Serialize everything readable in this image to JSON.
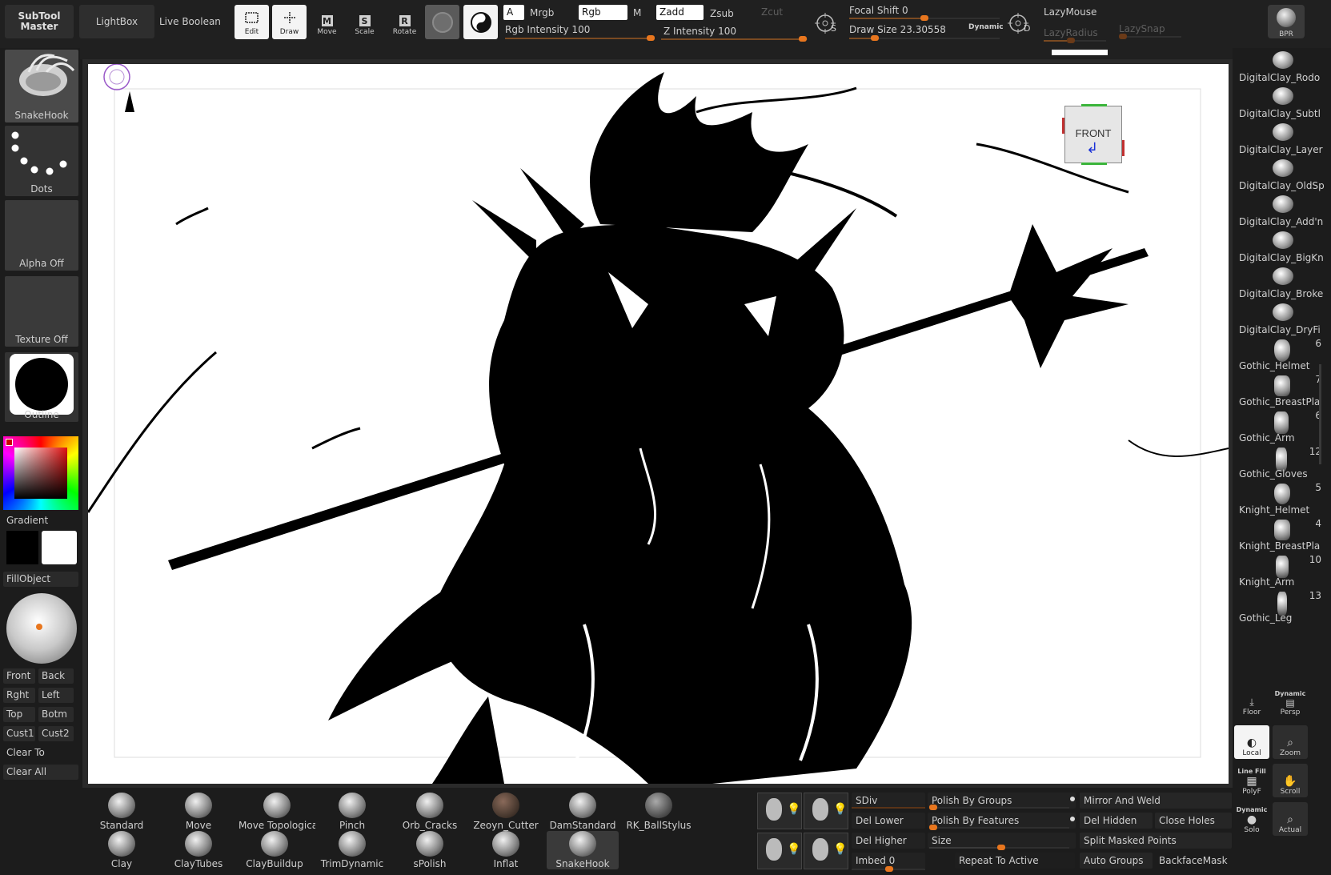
{
  "top": {
    "subtool_master": "SubTool Master",
    "lightbox": "LightBox",
    "live_boolean": "Live Boolean",
    "tools": [
      {
        "label": "Edit",
        "glyph": "⬚"
      },
      {
        "label": "Draw",
        "glyph": "✎"
      },
      {
        "label": "Move",
        "glyph": "M"
      },
      {
        "label": "Scale",
        "glyph": "S"
      },
      {
        "label": "Rotate",
        "glyph": "R"
      }
    ],
    "a_field": "A",
    "mrgb": "Mrgb",
    "rgb_field": "Rgb",
    "m": "M",
    "zadd_field": "Zadd",
    "zsub": "Zsub",
    "zcut": "Zcut",
    "rgb_intensity": "Rgb Intensity 100",
    "z_intensity": "Z Intensity 100",
    "focal_shift": "Focal Shift 0",
    "draw_size": "Draw Size 23.30558",
    "dynamic": "Dynamic",
    "lazymouse": "LazyMouse",
    "lazyradius": "LazyRadius",
    "lazysnap": "LazySnap",
    "s_label": "S",
    "d_label": "D",
    "bpr": "BPR"
  },
  "left": {
    "brush_name": "SnakeHook",
    "stroke_name": "Dots",
    "alpha": "Alpha Off",
    "texture": "Texture Off",
    "material": "Outline",
    "gradient": "Gradient",
    "fillobject": "FillObject",
    "views": [
      "Front",
      "Back",
      "Rght",
      "Left",
      "Top",
      "Botm",
      "Cust1",
      "Cust2"
    ],
    "clear_to": "Clear To",
    "clear_all": "Clear All"
  },
  "canvas": {
    "navcube_label": "FRONT"
  },
  "right": {
    "brushes": [
      {
        "name": "DigitalClay_Rodo",
        "count": ""
      },
      {
        "name": "DigitalClay_Subtl",
        "count": ""
      },
      {
        "name": "DigitalClay_Layer",
        "count": ""
      },
      {
        "name": "DigitalClay_OldSp",
        "count": ""
      },
      {
        "name": "DigitalClay_Add'n",
        "count": ""
      },
      {
        "name": "DigitalClay_BigKn",
        "count": ""
      },
      {
        "name": "DigitalClay_Broke",
        "count": ""
      },
      {
        "name": "DigitalClay_DryFi",
        "count": ""
      },
      {
        "name": "Gothic_Helmet",
        "count": "6"
      },
      {
        "name": "Gothic_BreastPla",
        "count": "7"
      },
      {
        "name": "Gothic_Arm",
        "count": "6"
      },
      {
        "name": "Gothic_Gloves",
        "count": "12"
      },
      {
        "name": "Knight_Helmet",
        "count": "5"
      },
      {
        "name": "Knight_BreastPla",
        "count": "4"
      },
      {
        "name": "Knight_Arm",
        "count": "10"
      },
      {
        "name": "Gothic_Leg",
        "count": "13"
      }
    ],
    "floor": "Floor",
    "persp": "Persp",
    "dynamic": "Dynamic",
    "local": "Local",
    "zoom": "Zoom",
    "line_fill": "Line Fill",
    "polyf": "PolyF",
    "scroll": "Scroll",
    "dynamic2": "Dynamic",
    "solo": "Solo",
    "actual": "Actual"
  },
  "bottom": {
    "brushes_row1": [
      "Standard",
      "Move",
      "Move Topologica",
      "Pinch",
      "Orb_Cracks",
      "Zeoyn_Cutter",
      "DamStandard",
      "RK_BallStylus"
    ],
    "brushes_row2": [
      "Clay",
      "ClayTubes",
      "ClayBuildup",
      "TrimDynamic",
      "sPolish",
      "Inflat",
      "SnakeHook"
    ],
    "sdiv": "SDiv",
    "del_lower": "Del Lower",
    "del_higher": "Del Higher",
    "imbed": "Imbed 0",
    "polish_groups": "Polish By Groups",
    "polish_features": "Polish By Features",
    "size": "Size",
    "repeat_active": "Repeat To Active",
    "mirror_weld": "Mirror And Weld",
    "del_hidden": "Del Hidden",
    "close_holes": "Close Holes",
    "split_masked": "Split Masked Points",
    "auto_groups": "Auto Groups",
    "backface_mask": "BackfaceMask"
  }
}
